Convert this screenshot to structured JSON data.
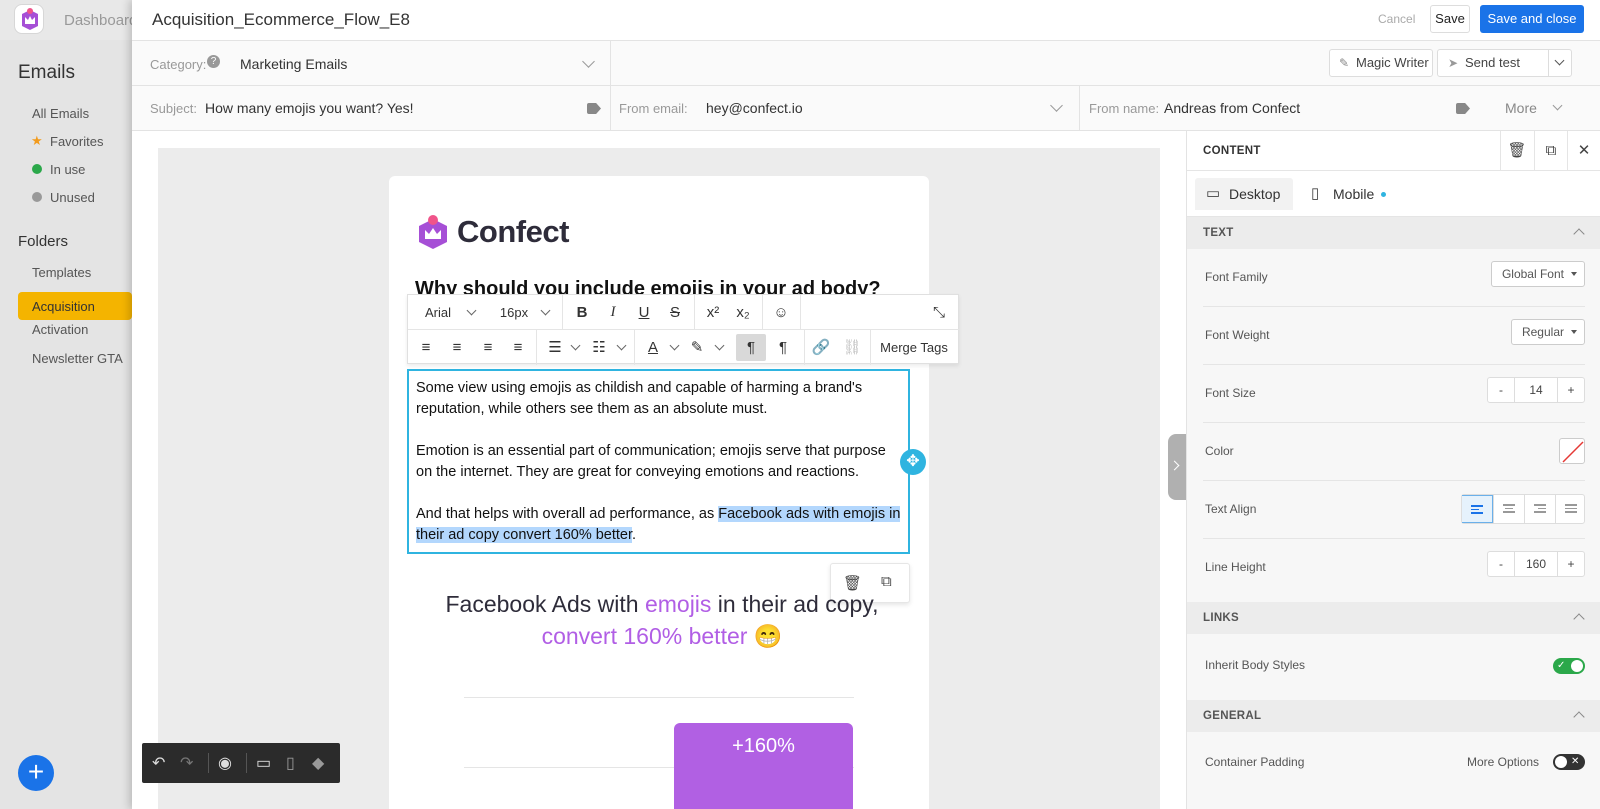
{
  "app": {
    "nav_dashboard": "Dashboard",
    "sidebar_title": "Emails",
    "sidebar_items": [
      "All Emails",
      "Favorites",
      "In use",
      "Unused"
    ],
    "folders_title": "Folders",
    "folder_items": [
      "Templates",
      "Acquisition",
      "Activation",
      "Newsletter GTA"
    ],
    "fab_label": "+",
    "colors": {
      "accent": "#1a73e8",
      "active_folder": "#f4b400",
      "in_use": "#2ba84a",
      "unused": "#999999",
      "favorite": "#f29b1d"
    }
  },
  "modal": {
    "title": "Acquisition_Ecommerce_Flow_E8",
    "cancel_label": "Cancel",
    "save_label": "Save",
    "save_close_label": "Save and close"
  },
  "meta": {
    "category_label": "Category:",
    "category_value": "Marketing Emails",
    "magic_writer_label": "Magic Writer",
    "send_test_label": "Send test",
    "subject_label": "Subject:",
    "subject_value": "How many emojis you want? Yes!",
    "from_email_label": "From email:",
    "from_email_value": "hey@confect.io",
    "from_name_label": "From name:",
    "from_name_value": "Andreas from Confect",
    "more_label": "More"
  },
  "editor": {
    "font_family": "Arial",
    "font_size": "16px",
    "merge_tags_label": "Merge Tags",
    "brand": "Confect",
    "heading": "Why should you include emojis in your ad body?",
    "para1": "Some view using emojis as childish and capable of harming a brand's reputation, while others see them as an absolute must.",
    "para2": "Emotion is an essential part of communication; emojis serve that purpose on the internet. They are great for conveying emotions and reactions.",
    "para3_pre": "And that helps with overall ad performance, as ",
    "para3_sel": "Facebook ads with emojis in their ad copy convert 160% better",
    "para3_post": ".",
    "promo_1": "Facebook Ads with ",
    "promo_2": "emojis",
    "promo_3": " in their ad copy, ",
    "promo_4": "convert 160% better",
    "promo_5": " 😁",
    "stat": "+160%"
  },
  "panel": {
    "title": "CONTENT",
    "tab_desktop": "Desktop",
    "tab_mobile": "Mobile",
    "sec_text": "TEXT",
    "font_family_label": "Font Family",
    "font_family_value": "Global Font",
    "font_weight_label": "Font Weight",
    "font_weight_value": "Regular",
    "font_size_label": "Font Size",
    "font_size_value": "14",
    "color_label": "Color",
    "text_align_label": "Text Align",
    "text_align_value": "left",
    "line_height_label": "Line Height",
    "line_height_value": "160",
    "sec_links": "LINKS",
    "inherit_label": "Inherit Body Styles",
    "inherit_on": true,
    "sec_general": "GENERAL",
    "padding_label": "Container Padding",
    "more_options_label": "More Options",
    "more_options_on": false,
    "stepper_minus": "-",
    "stepper_plus": "+"
  }
}
